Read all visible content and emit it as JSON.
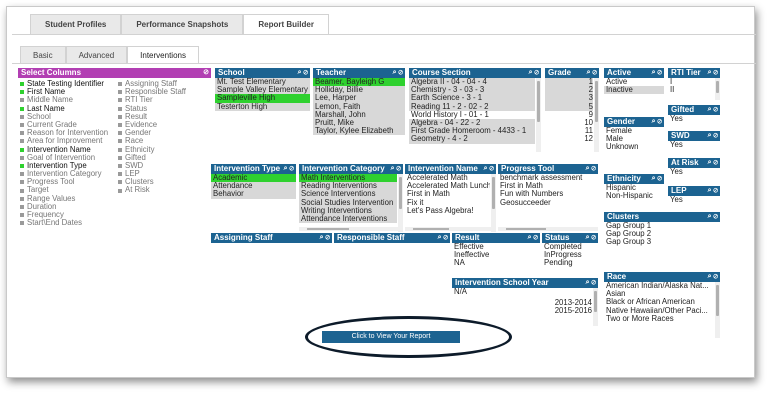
{
  "top_tabs": [
    "Student Profiles",
    "Performance Snapshots",
    "Report Builder"
  ],
  "sub_tabs": [
    "Basic",
    "Advanced",
    "Interventions"
  ],
  "select_columns": {
    "title": "Select Columns",
    "left": [
      {
        "label": "State Testing Identifier",
        "on": true
      },
      {
        "label": "First Name",
        "on": true
      },
      {
        "label": "Middle Name",
        "on": false
      },
      {
        "label": "Last Name",
        "on": true
      },
      {
        "label": "School",
        "on": false
      },
      {
        "label": "Current Grade",
        "on": false
      },
      {
        "label": "Reason for Intervention",
        "on": false
      },
      {
        "label": "Area for Improvement",
        "on": false
      },
      {
        "label": "Intervention Name",
        "on": true
      },
      {
        "label": "Goal of Intervention",
        "on": false
      },
      {
        "label": "Intervention Type",
        "on": true
      },
      {
        "label": "Intervention Category",
        "on": false
      },
      {
        "label": "Progress Tool",
        "on": false
      },
      {
        "label": "Target",
        "on": false
      },
      {
        "label": "Range Values",
        "on": false
      },
      {
        "label": "Duration",
        "on": false
      },
      {
        "label": "Frequency",
        "on": false
      },
      {
        "label": "Start\\End Dates",
        "on": false
      }
    ],
    "right": [
      {
        "label": "Assigning Staff",
        "on": false
      },
      {
        "label": "Responsible Staff",
        "on": false
      },
      {
        "label": "RTI Tier",
        "on": false
      },
      {
        "label": "Status",
        "on": false
      },
      {
        "label": "Result",
        "on": false
      },
      {
        "label": "Evidence",
        "on": false
      },
      {
        "label": "Gender",
        "on": false
      },
      {
        "label": "Race",
        "on": false
      },
      {
        "label": "Ethnicity",
        "on": false
      },
      {
        "label": "Gifted",
        "on": false
      },
      {
        "label": "SWD",
        "on": false
      },
      {
        "label": "LEP",
        "on": false
      },
      {
        "label": "Clusters",
        "on": false
      },
      {
        "label": "At Risk",
        "on": false
      }
    ]
  },
  "boxes": {
    "school": {
      "title": "School",
      "items": [
        {
          "t": "Mt. Test Elementary",
          "s": "grey"
        },
        {
          "t": "Sample Valley Elementary",
          "s": "grey"
        },
        {
          "t": "Sampleville High",
          "s": "green"
        },
        {
          "t": "Testerton High",
          "s": "grey"
        }
      ]
    },
    "teacher": {
      "title": "Teacher",
      "items": [
        {
          "t": "Beamer, Bayleigh G",
          "s": "green"
        },
        {
          "t": "Holliday, Billie",
          "s": "grey"
        },
        {
          "t": "Lee, Harper",
          "s": "grey"
        },
        {
          "t": "Lemon, Faith",
          "s": "grey"
        },
        {
          "t": "Marshall, John",
          "s": "grey"
        },
        {
          "t": "Pruitt, Mike",
          "s": "grey"
        },
        {
          "t": "Taylor, Kylee Elizabeth",
          "s": "grey"
        }
      ]
    },
    "course": {
      "title": "Course Section",
      "items": [
        {
          "t": "Algebra II - 04 - 04 - 4",
          "s": "grey"
        },
        {
          "t": "Chemistry - 3 - 03 - 3",
          "s": "grey"
        },
        {
          "t": "Earth Science - 3 - 1",
          "s": "grey"
        },
        {
          "t": "Reading 11 - 2 - 02 - 2",
          "s": "grey"
        },
        {
          "t": "World History I - 01 - 1",
          "s": "none"
        },
        {
          "t": "Algebra - 04 - 22 - 2",
          "s": "grey"
        },
        {
          "t": "First Grade Homeroom - 4433 - 1",
          "s": "grey"
        },
        {
          "t": "Geometry -  4 - 2",
          "s": "grey"
        }
      ]
    },
    "grade": {
      "title": "Grade",
      "items": [
        {
          "t": "1",
          "s": "grey"
        },
        {
          "t": "2",
          "s": "grey"
        },
        {
          "t": "3",
          "s": "grey"
        },
        {
          "t": "5",
          "s": "grey"
        },
        {
          "t": "9",
          "s": "none"
        },
        {
          "t": "10",
          "s": "none"
        },
        {
          "t": "11",
          "s": "none"
        },
        {
          "t": "12",
          "s": "none"
        }
      ]
    },
    "active": {
      "title": "Active",
      "items": [
        {
          "t": "Active",
          "s": "none"
        },
        {
          "t": "Inactive",
          "s": "grey"
        }
      ]
    },
    "rti": {
      "title": "RTI Tier",
      "items": [
        {
          "t": "I",
          "s": "none"
        },
        {
          "t": "II",
          "s": "none"
        }
      ]
    },
    "gender": {
      "title": "Gender",
      "items": [
        {
          "t": "Female",
          "s": "none"
        },
        {
          "t": "Male",
          "s": "none"
        },
        {
          "t": "Unknown",
          "s": "none"
        }
      ]
    },
    "gifted": {
      "title": "Gifted",
      "items": [
        {
          "t": "Yes",
          "s": "none"
        }
      ]
    },
    "swd": {
      "title": "SWD",
      "items": [
        {
          "t": "Yes",
          "s": "none"
        }
      ]
    },
    "atrisk": {
      "title": "At Risk",
      "items": [
        {
          "t": "Yes",
          "s": "none"
        }
      ]
    },
    "lep": {
      "title": "LEP",
      "items": [
        {
          "t": "Yes",
          "s": "none"
        }
      ]
    },
    "ethnicity": {
      "title": "Ethnicity",
      "items": [
        {
          "t": "Hispanic",
          "s": "none"
        },
        {
          "t": "Non-Hispanic",
          "s": "none"
        }
      ]
    },
    "clusters": {
      "title": "Clusters",
      "items": [
        {
          "t": "Gap Group 1",
          "s": "none"
        },
        {
          "t": "Gap Group 2",
          "s": "none"
        },
        {
          "t": "Gap Group 3",
          "s": "none"
        }
      ]
    },
    "itype": {
      "title": "Intervention Type",
      "items": [
        {
          "t": "Academic",
          "s": "green"
        },
        {
          "t": "Attendance",
          "s": "grey"
        },
        {
          "t": "Behavior",
          "s": "grey"
        }
      ]
    },
    "icat": {
      "title": "Intervention Category",
      "items": [
        {
          "t": "Math Interventions",
          "s": "green"
        },
        {
          "t": "Reading Interventions",
          "s": "grey"
        },
        {
          "t": "Science Interventions",
          "s": "grey"
        },
        {
          "t": "Social Studies Intervention",
          "s": "grey"
        },
        {
          "t": "Writing Interventions",
          "s": "grey"
        },
        {
          "t": "Attendance Interventions",
          "s": "grey"
        }
      ]
    },
    "iname": {
      "title": "Intervention Name",
      "items": [
        {
          "t": "Accelerated Math",
          "s": "none"
        },
        {
          "t": "Accelerated Math Lunch",
          "s": "none"
        },
        {
          "t": "First in Math",
          "s": "none"
        },
        {
          "t": "Fix it",
          "s": "none"
        },
        {
          "t": "Let's Pass Algebra!",
          "s": "none"
        }
      ]
    },
    "ptool": {
      "title": "Progress Tool",
      "items": [
        {
          "t": "benchmark assessment",
          "s": "none"
        },
        {
          "t": "First in Math",
          "s": "none"
        },
        {
          "t": "Fun with Numbers",
          "s": "none"
        },
        {
          "t": "Geosucceeder",
          "s": "none"
        }
      ]
    },
    "astaff": {
      "title": "Assigning Staff",
      "items": []
    },
    "rstaff": {
      "title": "Responsible Staff",
      "items": []
    },
    "result": {
      "title": "Result",
      "items": [
        {
          "t": "Effective",
          "s": "none"
        },
        {
          "t": "Ineffective",
          "s": "none"
        },
        {
          "t": "NA",
          "s": "none"
        }
      ]
    },
    "status": {
      "title": "Status",
      "items": [
        {
          "t": "Completed",
          "s": "none"
        },
        {
          "t": "InProgress",
          "s": "none"
        },
        {
          "t": "Pending",
          "s": "none"
        }
      ]
    },
    "isy": {
      "title": "Intervention School Year",
      "items": [
        {
          "t": "N/A",
          "s": "none"
        }
      ]
    },
    "race": {
      "title": "Race",
      "items": [
        {
          "t": "American Indian/Alaska Nat...",
          "s": "none"
        },
        {
          "t": "Asian",
          "s": "none"
        },
        {
          "t": "Black or African American",
          "s": "none"
        },
        {
          "t": "Native Hawaiian/Other Paci...",
          "s": "none"
        },
        {
          "t": "Two or More Races",
          "s": "none"
        }
      ]
    }
  },
  "isy_years": [
    "2013-2014",
    "2015-2016"
  ],
  "view_button": "Click to View Your Report",
  "colors": {
    "header": "#1c6391",
    "select_columns": "#b23fb3",
    "selected": "#2fd12f",
    "unselected": "#d8d8d8"
  }
}
